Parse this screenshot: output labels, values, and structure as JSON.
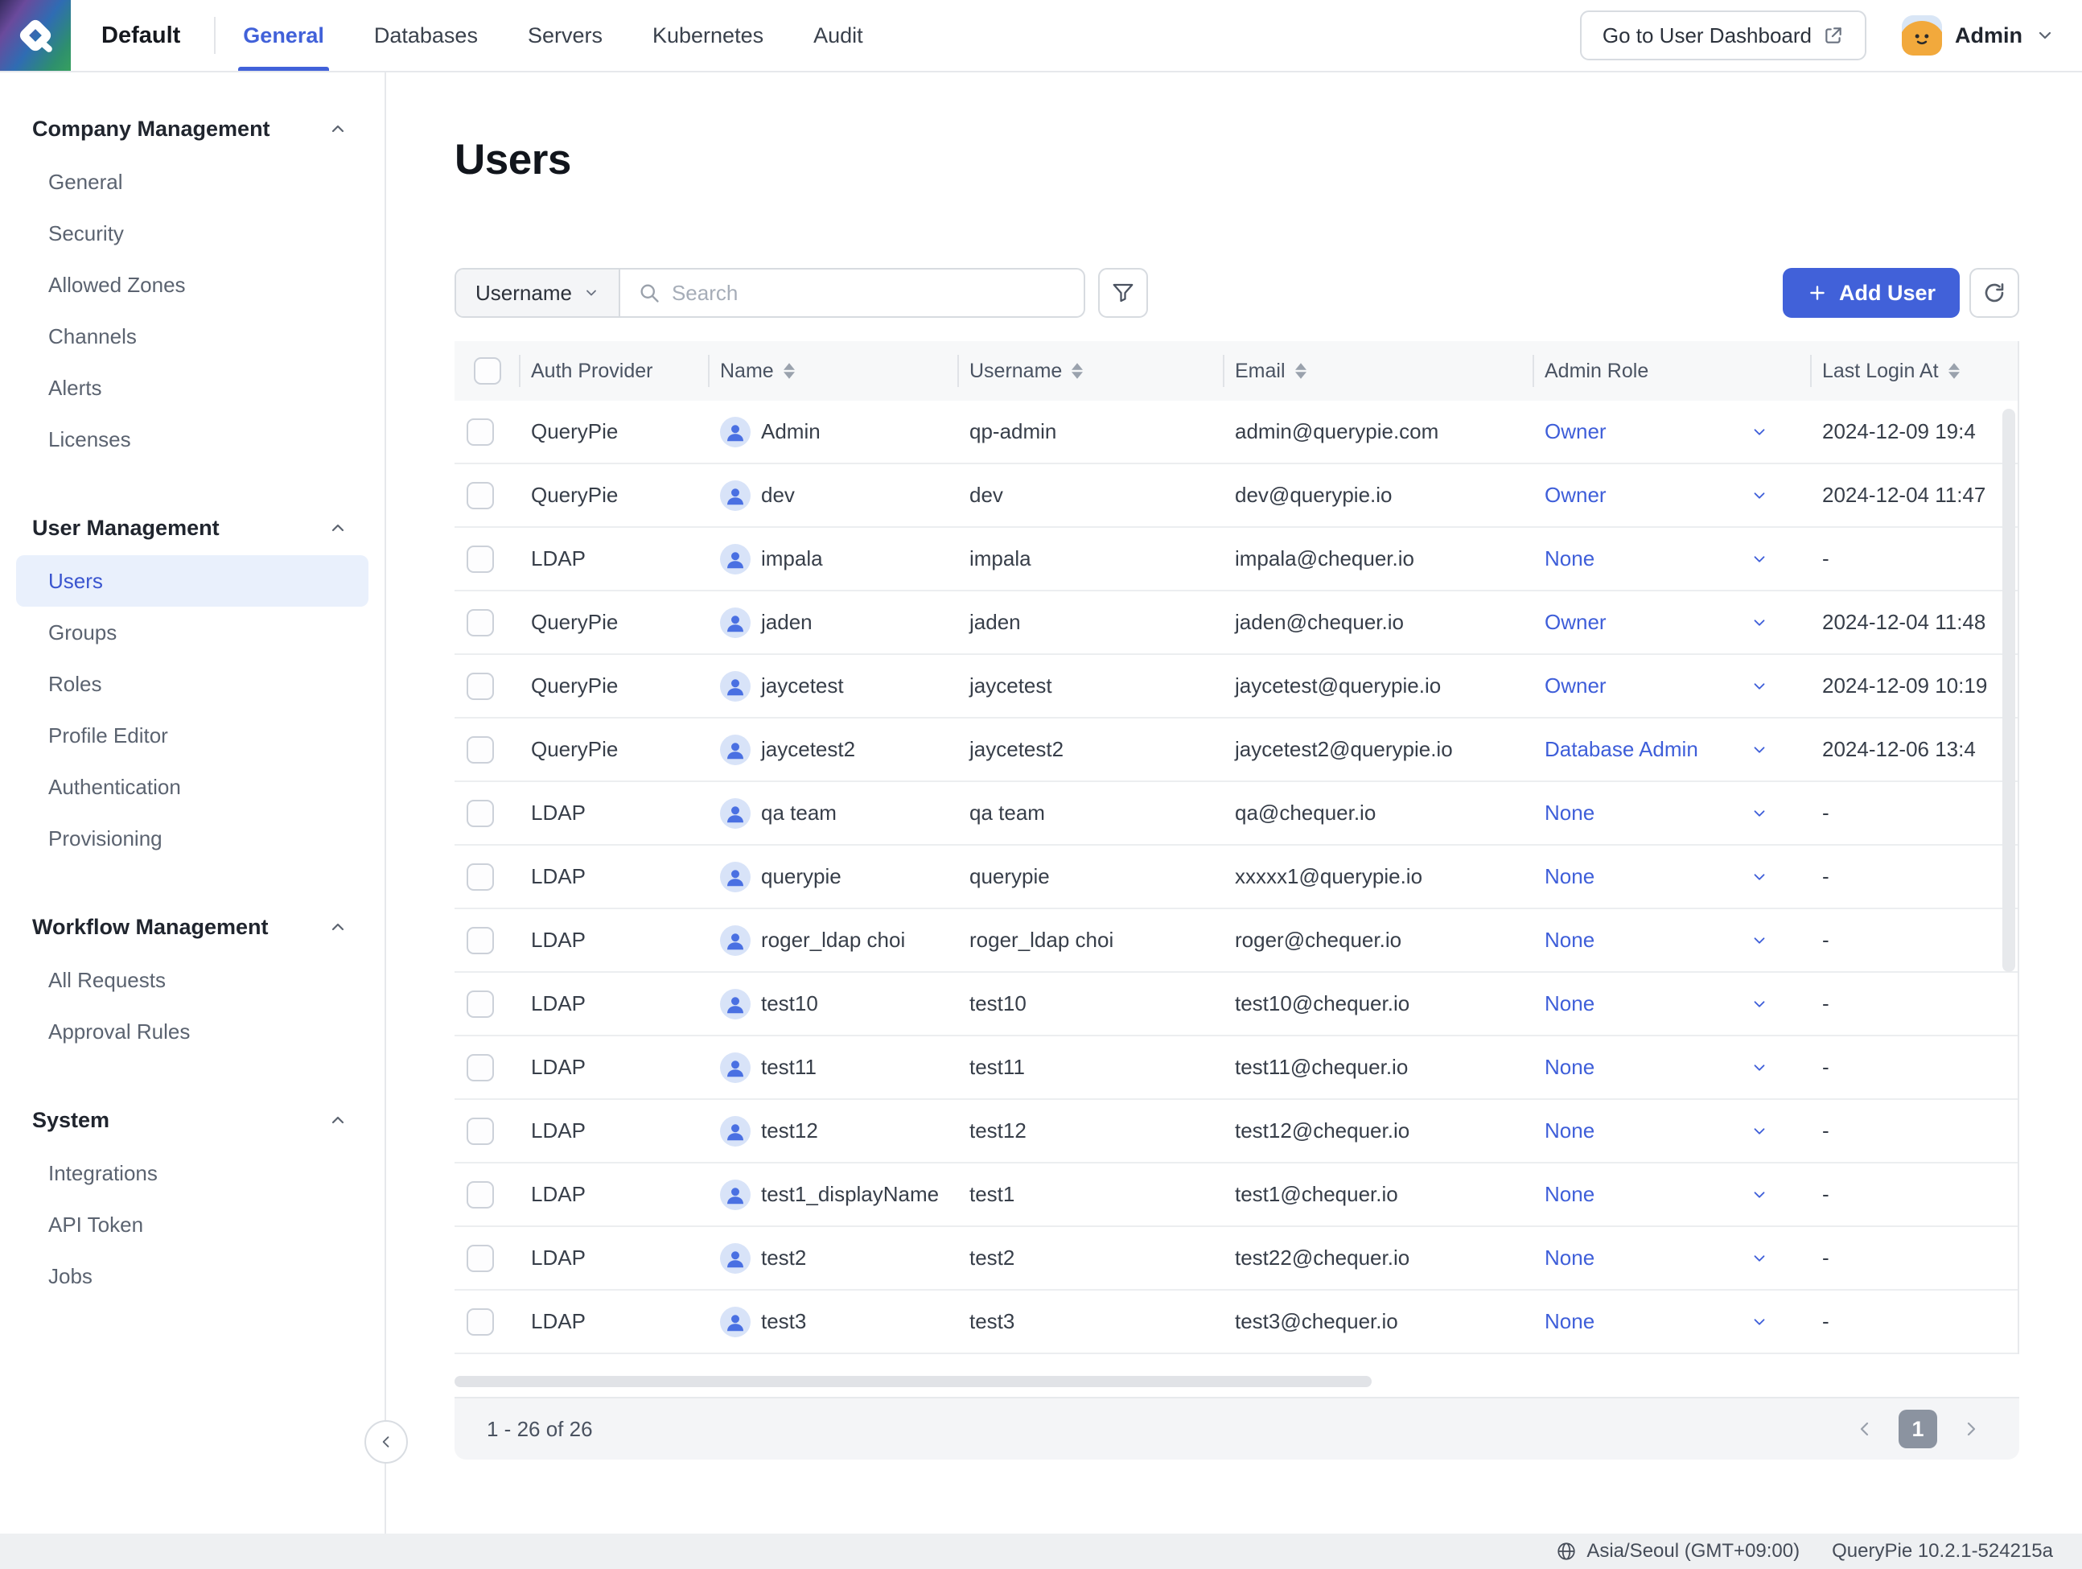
{
  "navbar": {
    "org_name": "Default",
    "tabs": [
      {
        "label": "General",
        "active": true
      },
      {
        "label": "Databases",
        "active": false
      },
      {
        "label": "Servers",
        "active": false
      },
      {
        "label": "Kubernetes",
        "active": false
      },
      {
        "label": "Audit",
        "active": false
      }
    ],
    "dashboard_button_label": "Go to User Dashboard",
    "user_name": "Admin"
  },
  "sidebar": {
    "sections": [
      {
        "title": "Company Management",
        "items": [
          {
            "label": "General",
            "active": false
          },
          {
            "label": "Security",
            "active": false
          },
          {
            "label": "Allowed Zones",
            "active": false
          },
          {
            "label": "Channels",
            "active": false
          },
          {
            "label": "Alerts",
            "active": false
          },
          {
            "label": "Licenses",
            "active": false
          }
        ]
      },
      {
        "title": "User Management",
        "items": [
          {
            "label": "Users",
            "active": true
          },
          {
            "label": "Groups",
            "active": false
          },
          {
            "label": "Roles",
            "active": false
          },
          {
            "label": "Profile Editor",
            "active": false
          },
          {
            "label": "Authentication",
            "active": false
          },
          {
            "label": "Provisioning",
            "active": false
          }
        ]
      },
      {
        "title": "Workflow Management",
        "items": [
          {
            "label": "All Requests",
            "active": false
          },
          {
            "label": "Approval Rules",
            "active": false
          }
        ]
      },
      {
        "title": "System",
        "items": [
          {
            "label": "Integrations",
            "active": false
          },
          {
            "label": "API Token",
            "active": false
          },
          {
            "label": "Jobs",
            "active": false
          }
        ]
      }
    ]
  },
  "page": {
    "title": "Users"
  },
  "toolbar": {
    "filter_field": "Username",
    "search_placeholder": "Search",
    "add_user_label": "Add User"
  },
  "table": {
    "columns": [
      {
        "label": "Auth Provider",
        "sortable": false
      },
      {
        "label": "Name",
        "sortable": true
      },
      {
        "label": "Username",
        "sortable": true
      },
      {
        "label": "Email",
        "sortable": true
      },
      {
        "label": "Admin Role",
        "sortable": false
      },
      {
        "label": "Last Login At",
        "sortable": true
      }
    ],
    "rows": [
      {
        "auth_provider": "QueryPie",
        "name": "Admin",
        "username": "qp-admin",
        "email": "admin@querypie.com",
        "admin_role": "Owner",
        "last_login": "2024-12-09 19:4"
      },
      {
        "auth_provider": "QueryPie",
        "name": "dev",
        "username": "dev",
        "email": "dev@querypie.io",
        "admin_role": "Owner",
        "last_login": "2024-12-04 11:47"
      },
      {
        "auth_provider": "LDAP",
        "name": "impala",
        "username": "impala",
        "email": "impala@chequer.io",
        "admin_role": "None",
        "last_login": "-"
      },
      {
        "auth_provider": "QueryPie",
        "name": "jaden",
        "username": "jaden",
        "email": "jaden@chequer.io",
        "admin_role": "Owner",
        "last_login": "2024-12-04 11:48"
      },
      {
        "auth_provider": "QueryPie",
        "name": "jaycetest",
        "username": "jaycetest",
        "email": "jaycetest@querypie.io",
        "admin_role": "Owner",
        "last_login": "2024-12-09 10:19"
      },
      {
        "auth_provider": "QueryPie",
        "name": "jaycetest2",
        "username": "jaycetest2",
        "email": "jaycetest2@querypie.io",
        "admin_role": "Database Admin",
        "last_login": "2024-12-06 13:4"
      },
      {
        "auth_provider": "LDAP",
        "name": "qa team",
        "username": "qa team",
        "email": "qa@chequer.io",
        "admin_role": "None",
        "last_login": "-"
      },
      {
        "auth_provider": "LDAP",
        "name": "querypie",
        "username": "querypie",
        "email": "xxxxx1@querypie.io",
        "admin_role": "None",
        "last_login": "-"
      },
      {
        "auth_provider": "LDAP",
        "name": "roger_ldap choi",
        "username": "roger_ldap choi",
        "email": "roger@chequer.io",
        "admin_role": "None",
        "last_login": "-"
      },
      {
        "auth_provider": "LDAP",
        "name": "test10",
        "username": "test10",
        "email": "test10@chequer.io",
        "admin_role": "None",
        "last_login": "-"
      },
      {
        "auth_provider": "LDAP",
        "name": "test11",
        "username": "test11",
        "email": "test11@chequer.io",
        "admin_role": "None",
        "last_login": "-"
      },
      {
        "auth_provider": "LDAP",
        "name": "test12",
        "username": "test12",
        "email": "test12@chequer.io",
        "admin_role": "None",
        "last_login": "-"
      },
      {
        "auth_provider": "LDAP",
        "name": "test1_displayName",
        "username": "test1",
        "email": "test1@chequer.io",
        "admin_role": "None",
        "last_login": "-"
      },
      {
        "auth_provider": "LDAP",
        "name": "test2",
        "username": "test2",
        "email": "test22@chequer.io",
        "admin_role": "None",
        "last_login": "-"
      },
      {
        "auth_provider": "LDAP",
        "name": "test3",
        "username": "test3",
        "email": "test3@chequer.io",
        "admin_role": "None",
        "last_login": "-"
      }
    ]
  },
  "pagination": {
    "range": "1 - 26 of 26",
    "current_page": "1"
  },
  "footer": {
    "timezone": "Asia/Seoul (GMT+09:00)",
    "version": "QueryPie 10.2.1-524215a"
  },
  "colors": {
    "accent": "#4161d9",
    "link": "#3e5ed9",
    "active_item_bg": "#e9f0fc",
    "active_item_text": "#3a55cf",
    "page_box": "#8b93a0"
  }
}
